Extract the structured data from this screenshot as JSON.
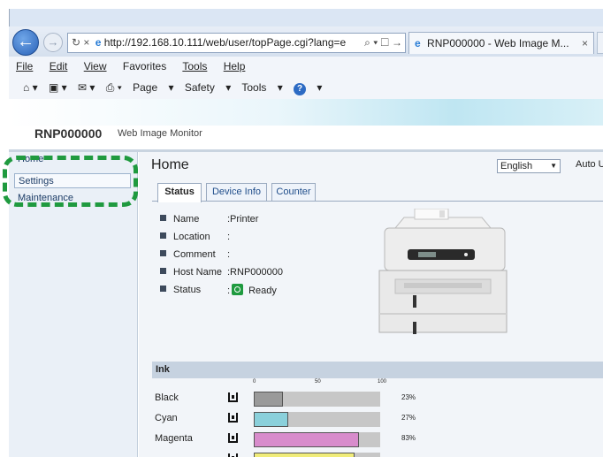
{
  "browser": {
    "address_url": "http://192.168.10.111/web/user/topPage.cgi?lang=e",
    "address_tail": "⌕ ▾ ☐ →",
    "tab_title": "RNP000000 - Web Image M...",
    "tab_close": "×",
    "menu": [
      "File",
      "Edit",
      "View",
      "Favorites",
      "Tools",
      "Help"
    ],
    "command": [
      "Page",
      "Safety",
      "Tools"
    ]
  },
  "header": {
    "device_name": "RNP000000",
    "app_name": "Web Image Monitor"
  },
  "sidebar": {
    "items": [
      {
        "label": "Home"
      },
      {
        "label": "Settings"
      },
      {
        "label": "Maintenance"
      }
    ]
  },
  "page": {
    "title": "Home",
    "language": "English",
    "auto_label": "Auto U"
  },
  "tabs": [
    {
      "label": "Status"
    },
    {
      "label": "Device Info"
    },
    {
      "label": "Counter"
    }
  ],
  "status_info": [
    {
      "label": "Name",
      "value": ":Printer"
    },
    {
      "label": "Location",
      "value": ":"
    },
    {
      "label": "Comment",
      "value": ":"
    },
    {
      "label": "Host Name",
      "value": ":RNP000000"
    },
    {
      "label": "Status",
      "value": "Ready",
      "prefix": ":"
    }
  ],
  "ink": {
    "heading": "Ink",
    "scale": [
      "0",
      "50",
      "100"
    ],
    "rows": [
      {
        "name": "Black",
        "percent": 23,
        "label": "23%",
        "color": "#9a9a9a"
      },
      {
        "name": "Cyan",
        "percent": 27,
        "label": "27%",
        "color": "#8ad0db"
      },
      {
        "name": "Magenta",
        "percent": 83,
        "label": "83%",
        "color": "#d88ccc"
      },
      {
        "name": "",
        "percent": 80,
        "label": "",
        "color": "#f0ec7a"
      }
    ]
  }
}
